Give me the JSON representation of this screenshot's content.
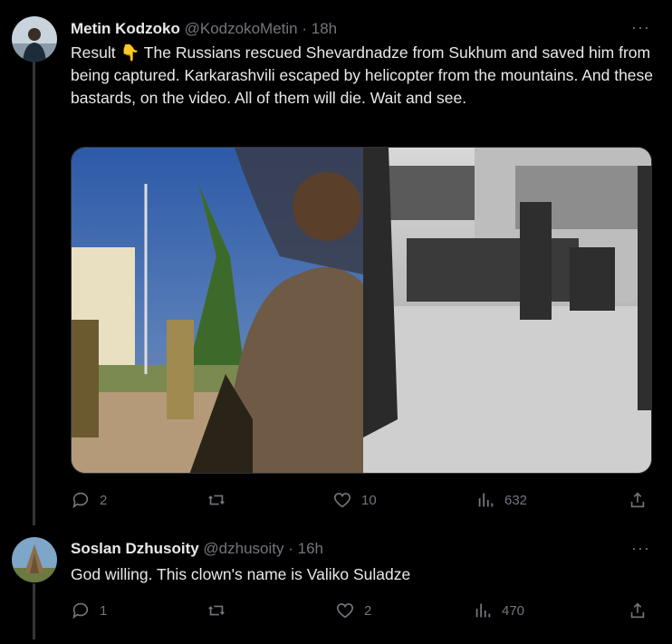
{
  "tweets": [
    {
      "name": "Metin Kodzoko",
      "handle": "@KodzokoMetin",
      "sep": "·",
      "time": "18h",
      "text": "Result 👇 The Russians rescued Shevardnadze from Sukhum and saved him from being captured. Karkarashvili escaped by helicopter from the mountains.  And these bastards, on the video. All of them will die. Wait and see.",
      "replies": "2",
      "retweets": "",
      "likes": "10",
      "views": "632",
      "more": "···"
    },
    {
      "name": "Soslan Dzhusoity",
      "handle": "@dzhusoity",
      "sep": "·",
      "time": "16h",
      "text": "God willing. This clown's name is Valiko Suladze",
      "replies": "1",
      "retweets": "",
      "likes": "2",
      "views": "470",
      "more": "···"
    }
  ],
  "colors": {
    "background": "#000000",
    "text": "#e7e9ea",
    "secondary": "#71767b",
    "divider": "#2f3336"
  },
  "icons": [
    "reply-icon",
    "retweet-icon",
    "like-icon",
    "views-icon",
    "share-icon",
    "more-icon"
  ]
}
